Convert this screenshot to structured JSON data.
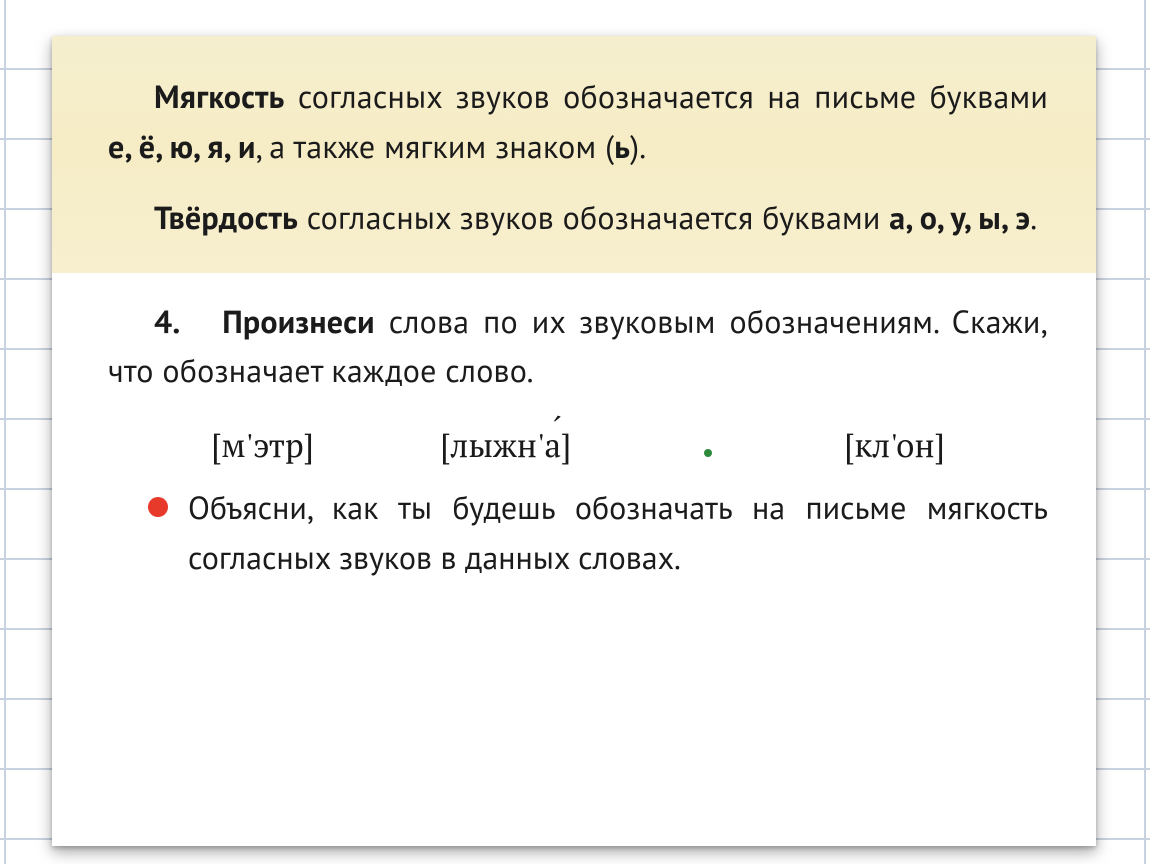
{
  "yellow": {
    "p1": {
      "lead": "Мягкость",
      "t1": " согласных звуков обозначается на письме буквами ",
      "letters": "е, ё, ю, я, и",
      "t2": ", а так­же мягким знаком (",
      "soft_sign": "ь",
      "t3": ")."
    },
    "p2": {
      "lead": "Твёрдость",
      "t1": " согласных звуков обозначается буквами ",
      "letters": "а, о, у, ы, э",
      "t2": "."
    }
  },
  "exercise": {
    "number": "4.",
    "title_bold": "Произнеси",
    "title_rest": " слова по их звуковым обозна­чениям. Скажи, что обозначает каждое слово.",
    "phon1": "[м'этр]",
    "phon2_pre": "[лыжн'",
    "phon2_accent": "а",
    "phon2_post": "]",
    "phon3": "[кл'он]",
    "bullet": "Объясни, как ты будешь обозначать на письме мягкость согласных звуков в данных словах."
  }
}
